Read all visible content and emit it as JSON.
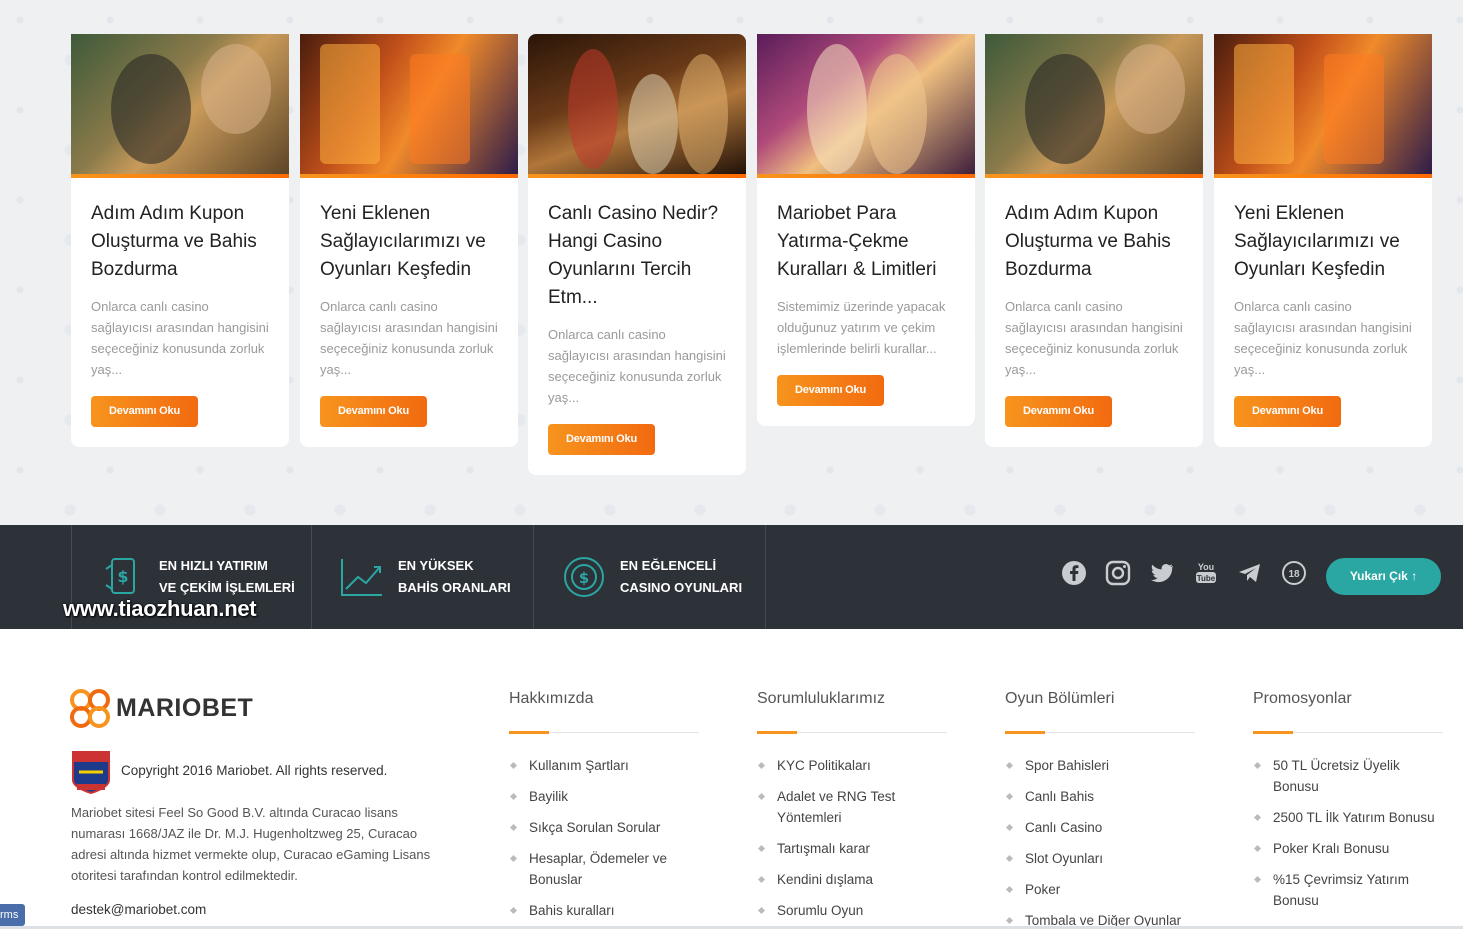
{
  "blog": {
    "cards": [
      {
        "title": "Adım Adım Kupon Oluşturma ve Bahis Bozdurma",
        "excerpt": "Onlarca canlı casino sağlayıcısı arasından hangisini seçeceğiniz konusunda zorluk yaş...",
        "button": "Devamını Oku"
      },
      {
        "title": "Yeni Eklenen Sağlayıcılarımızı ve Oyunları Keşfedin",
        "excerpt": "Onlarca canlı casino sağlayıcısı arasından hangisini seçeceğiniz konusunda zorluk yaş...",
        "button": "Devamını Oku"
      },
      {
        "title": "Canlı Casino Nedir? Hangi Casino Oyunlarını Tercih Etm...",
        "excerpt": "Onlarca canlı casino sağlayıcısı arasından hangisini seçeceğiniz konusunda zorluk yaş...",
        "button": "Devamını Oku"
      },
      {
        "title": "Mariobet Para Yatırma-Çekme Kuralları & Limitleri",
        "excerpt": "Sistemimiz üzerinde yapacak olduğunuz yatırım ve çekim işlemlerinde belirli kurallar...",
        "button": "Devamını Oku"
      },
      {
        "title": "Adım Adım Kupon Oluşturma ve Bahis Bozdurma",
        "excerpt": "Onlarca canlı casino sağlayıcısı arasından hangisini seçeceğiniz konusunda zorluk yaş...",
        "button": "Devamını Oku"
      },
      {
        "title": "Yeni Eklenen Sağlayıcılarımızı ve Oyunları Keşfedin",
        "excerpt": "Onlarca canlı casino sağlayıcısı arasından hangisini seçeceğiniz konusunda zorluk yaş...",
        "button": "Devamını Oku"
      }
    ]
  },
  "features": [
    {
      "line1": "EN HIZLI YATIRIM",
      "line2": "VE ÇEKİM İŞLEMLERİ",
      "icon": "money-transfer-icon"
    },
    {
      "line1": "EN YÜKSEK",
      "line2": "BAHİS ORANLARI",
      "icon": "chart-up-icon"
    },
    {
      "line1": "EN EĞLENCELİ",
      "line2": "CASINO OYUNLARI",
      "icon": "casino-chip-icon"
    }
  ],
  "watermark": "www.tiaozhuan.net",
  "social": [
    "facebook-icon",
    "instagram-icon",
    "twitter-icon",
    "youtube-icon",
    "telegram-icon",
    "age-18-icon"
  ],
  "scroll_top": {
    "label": "Yukarı Çık"
  },
  "footer": {
    "brand": "MARIOBET",
    "copyright": "Copyright 2016 Mariobet. All rights reserved.",
    "license": "Mariobet sitesi Feel So Good B.V. altında Curacao lisans numarası 1668/JAZ ile Dr. M.J. Hugenholtzweg 25, Curacao adresi altında hizmet vermekte olup, Curacao eGaming Lisans otoritesi tarafından kontrol edilmektedir.",
    "email": "destek@mariobet.com",
    "columns": [
      {
        "title": "Hakkımızda",
        "links": [
          "Kullanım Şartları",
          "Bayilik",
          "Sıkça Sorulan Sorular",
          "Hesaplar, Ödemeler ve Bonuslar",
          "Bahis kuralları"
        ]
      },
      {
        "title": "Sorumluluklarımız",
        "links": [
          "KYC Politikaları",
          "Adalet ve RNG Test Yöntemleri",
          "Tartışmalı karar",
          "Kendini dışlama",
          "Sorumlu Oyun"
        ]
      },
      {
        "title": "Oyun Bölümleri",
        "links": [
          "Spor Bahisleri",
          "Canlı Bahis",
          "Canlı Casino",
          "Slot Oyunları",
          "Poker",
          "Tombala ve Diğer Oyunlar"
        ]
      },
      {
        "title": "Promosyonlar",
        "links": [
          "50 TL Ücretsiz Üyelik Bonusu",
          "2500 TL İlk Yatırım Bonusu",
          "Poker Kralı Bonusu",
          "%15 Çevrimsiz Yatırım Bonusu"
        ]
      }
    ]
  },
  "terms_tab": "rms",
  "colors": {
    "accent": "#f7941d",
    "teal": "#2aa6a3",
    "band": "#2d3239"
  }
}
